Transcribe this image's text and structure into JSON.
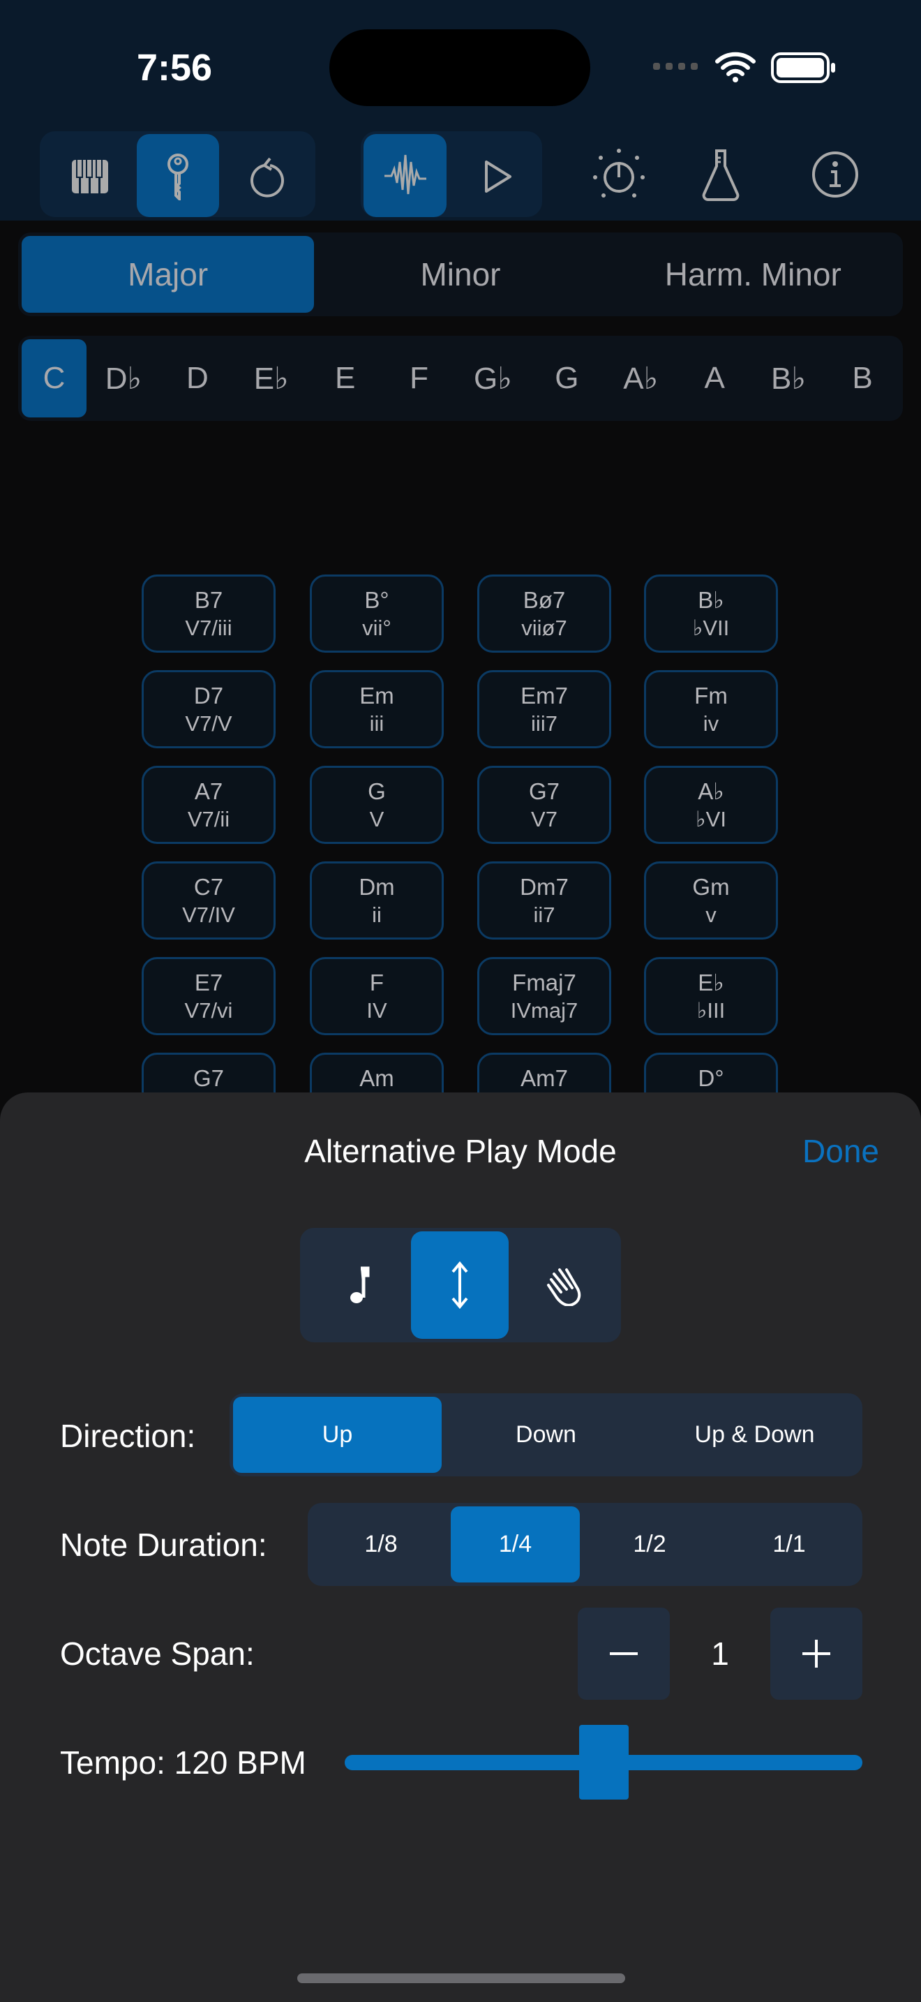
{
  "status_bar": {
    "time": "7:56"
  },
  "toolbar": {
    "group1": [
      {
        "icon": "piano-keys-icon",
        "selected": false
      },
      {
        "icon": "key-icon",
        "selected": true
      },
      {
        "icon": "undo-icon",
        "selected": false
      }
    ],
    "group2": [
      {
        "icon": "waveform-icon",
        "selected": true
      },
      {
        "icon": "play-icon",
        "selected": false
      }
    ],
    "right": [
      {
        "icon": "timer-icon"
      },
      {
        "icon": "flask-icon"
      },
      {
        "icon": "info-icon"
      }
    ]
  },
  "scale_types": {
    "items": [
      "Major",
      "Minor",
      "Harm. Minor"
    ],
    "selected": "Major"
  },
  "keys": {
    "items": [
      "C",
      "D♭",
      "D",
      "E♭",
      "E",
      "F",
      "G♭",
      "G",
      "A♭",
      "A",
      "B♭",
      "B"
    ],
    "selected": "C"
  },
  "chords": [
    {
      "name": "B7",
      "roman": "V7/iii"
    },
    {
      "name": "B°",
      "roman": "vii°"
    },
    {
      "name": "Bø7",
      "roman": "viiø7"
    },
    {
      "name": "B♭",
      "roman": "♭VII"
    },
    {
      "name": "D7",
      "roman": "V7/V"
    },
    {
      "name": "Em",
      "roman": "iii"
    },
    {
      "name": "Em7",
      "roman": "iii7"
    },
    {
      "name": "Fm",
      "roman": "iv"
    },
    {
      "name": "A7",
      "roman": "V7/ii"
    },
    {
      "name": "G",
      "roman": "V"
    },
    {
      "name": "G7",
      "roman": "V7"
    },
    {
      "name": "A♭",
      "roman": "♭VI"
    },
    {
      "name": "C7",
      "roman": "V7/IV"
    },
    {
      "name": "Dm",
      "roman": "ii"
    },
    {
      "name": "Dm7",
      "roman": "ii7"
    },
    {
      "name": "Gm",
      "roman": "v"
    },
    {
      "name": "E7",
      "roman": "V7/vi"
    },
    {
      "name": "F",
      "roman": "IV"
    },
    {
      "name": "Fmaj7",
      "roman": "IVmaj7"
    },
    {
      "name": "E♭",
      "roman": "♭III"
    },
    {
      "name": "G7",
      "roman": ""
    },
    {
      "name": "Am",
      "roman": ""
    },
    {
      "name": "Am7",
      "roman": ""
    },
    {
      "name": "D°",
      "roman": ""
    }
  ],
  "sheet": {
    "title": "Alternative Play Mode",
    "done_label": "Done",
    "modes": [
      {
        "icon": "music-note-icon",
        "selected": false
      },
      {
        "icon": "up-down-arrow-icon",
        "selected": true
      },
      {
        "icon": "hand-icon",
        "selected": false
      }
    ],
    "direction": {
      "label": "Direction:",
      "options": [
        "Up",
        "Down",
        "Up & Down"
      ],
      "selected": "Up"
    },
    "note_duration": {
      "label": "Note Duration:",
      "options": [
        "1/8",
        "1/4",
        "1/2",
        "1/1"
      ],
      "selected": "1/4"
    },
    "octave_span": {
      "label": "Octave Span:",
      "value": "1"
    },
    "tempo": {
      "label": "Tempo: 120 BPM",
      "slider_fraction": 0.5
    }
  },
  "colors": {
    "accent": "#0672be",
    "selected_dark": "#06518a",
    "header_bg": "#0a1a2b",
    "sheet_bg": "#262628"
  }
}
